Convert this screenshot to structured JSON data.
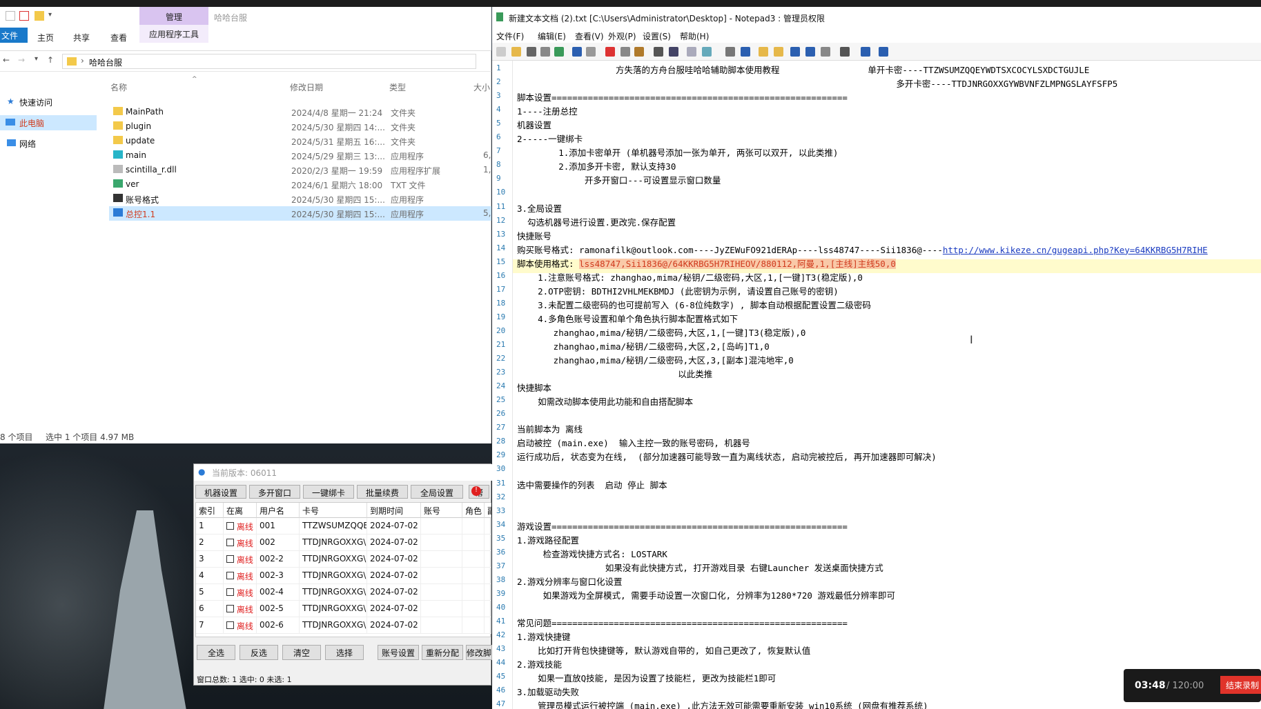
{
  "explorer": {
    "ribbon_manage": "管理",
    "ribbon_folder": "哈哈台服",
    "tabs": [
      "文件",
      "主页",
      "共享",
      "查看",
      "应用程序工具"
    ],
    "path": "哈哈台服",
    "nav": [
      "快速访问",
      "此电脑",
      "网络"
    ],
    "columns": [
      "名称",
      "修改日期",
      "类型",
      "大小"
    ],
    "files": [
      {
        "name": "MainPath",
        "date": "2024/4/8 星期一 21:24",
        "type": "文件夹",
        "size": ""
      },
      {
        "name": "plugin",
        "date": "2024/5/30 星期四 14:...",
        "type": "文件夹",
        "size": ""
      },
      {
        "name": "update",
        "date": "2024/5/31 星期五 16:...",
        "type": "文件夹",
        "size": ""
      },
      {
        "name": "main",
        "date": "2024/5/29 星期三 13:...",
        "type": "应用程序",
        "size": "6,"
      },
      {
        "name": "scintilla_r.dll",
        "date": "2020/2/3 星期一 19:59",
        "type": "应用程序扩展",
        "size": "1,"
      },
      {
        "name": "ver",
        "date": "2024/6/1 星期六 18:00",
        "type": "TXT 文件",
        "size": ""
      },
      {
        "name": "账号格式",
        "date": "2024/5/30 星期四 15:...",
        "type": "应用程序",
        "size": ""
      },
      {
        "name": "总控1.1",
        "date": "2024/5/30 星期四 15:...",
        "type": "应用程序",
        "size": "5,"
      }
    ],
    "status_items": "8 个项目",
    "status_selected": "选中 1 个项目  4.97 MB"
  },
  "tool": {
    "title": "当前版本: 06011",
    "buttons": [
      "机器设置",
      "多开窗口",
      "一键绑卡",
      "批量续费",
      "全局设置",
      "帮"
    ],
    "headers": [
      "索引",
      "在离",
      "用户名",
      "卡号",
      "到期时间",
      "账号",
      "角色",
      "副"
    ],
    "rows": [
      {
        "i": "1",
        "st": "离线",
        "user": "001",
        "card": "TTZWSUMZQQE",
        "exp": "2024-07-02"
      },
      {
        "i": "2",
        "st": "离线",
        "user": "002",
        "card": "TTDJNRGOXXG\\",
        "exp": "2024-07-02"
      },
      {
        "i": "3",
        "st": "离线",
        "user": "002-2",
        "card": "TTDJNRGOXXG\\",
        "exp": "2024-07-02"
      },
      {
        "i": "4",
        "st": "离线",
        "user": "002-3",
        "card": "TTDJNRGOXXG\\",
        "exp": "2024-07-02"
      },
      {
        "i": "5",
        "st": "离线",
        "user": "002-4",
        "card": "TTDJNRGOXXG\\",
        "exp": "2024-07-02"
      },
      {
        "i": "6",
        "st": "离线",
        "user": "002-5",
        "card": "TTDJNRGOXXG\\",
        "exp": "2024-07-02"
      },
      {
        "i": "7",
        "st": "离线",
        "user": "002-6",
        "card": "TTDJNRGOXXG\\",
        "exp": "2024-07-02"
      }
    ],
    "bottom_buttons": [
      "全选",
      "反选",
      "清空",
      "选择",
      "账号设置",
      "重新分配",
      "修改脚"
    ],
    "status": "窗口总数: 1  选中: 0  未选: 1"
  },
  "notepad": {
    "title": "新建文本文档 (2).txt [C:\\Users\\Administrator\\Desktop] - Notepad3 : 管理员权限",
    "menu": [
      "文件(F)",
      "编辑(E)",
      "查看(V)",
      "外观(P)",
      "设置(S)",
      "帮助(H)"
    ],
    "lines": [
      "                   方失落的方舟台服哇哈哈辅助脚本使用教程                 单开卡密----TTZWSUMZQQEYWDTSXCOCYLSXDCTGUJLE",
      "                                                                         多开卡密----TTDJNRGOXXGYWBVNFZLMPNGSLAYFSFP5",
      "脚本设置=========================================================",
      "1----注册总控",
      "机器设置",
      "2-----一键绑卡",
      "        1.添加卡密单开 (单机器号添加一张为单开, 两张可以双开, 以此类推)",
      "        2.添加多开卡密, 默认支持30",
      "             开多开窗口---可设置显示窗口数量",
      "",
      "3.全局设置",
      "  勾选机器号进行设置.更改完.保存配置",
      "快捷账号",
      "购买账号格式: ramonafilk@outlook.com----JyZEWuFO921dERAp----lss48747----Sii1836@----",
      "脚本使用格式: ",
      "    1.注意账号格式: zhanghao,mima/秘钥/二级密码,大区,1,[一键]T3(稳定版),0",
      "    2.OTP密钥: BDTHI2VHLMEKBMDJ (此密钥为示例, 请设置自己账号的密钥)",
      "    3.未配置二级密码的也可提前写入 (6-8位纯数字) , 脚本自动根据配置设置二级密码",
      "    4.多角色账号设置和单个角色执行脚本配置格式如下",
      "       zhanghao,mima/秘钥/二级密码,大区,1,[一键]T3(稳定版),0",
      "       zhanghao,mima/秘钥/二级密码,大区,2,[岛屿]T1,0",
      "       zhanghao,mima/秘钥/二级密码,大区,3,[副本]混沌地牢,0",
      "                               以此类推",
      "快捷脚本",
      "    如需改动脚本使用此功能和自由搭配脚本",
      "",
      "当前脚本为 离线",
      "启动被控 (main.exe)  输入主控一致的账号密码, 机器号",
      "运行成功后, 状态变为在线,  (部分加速器可能导致一直为离线状态, 启动完被控后, 再开加速器即可解决)",
      "",
      "选中需要操作的列表  启动 停止 脚本",
      "",
      "",
      "游戏设置=========================================================",
      "1.游戏路径配置",
      "     检查游戏快捷方式名: LOSTARK",
      "                 如果没有此快捷方式, 打开游戏目录 右键Launcher 发送桌面快捷方式",
      "2.游戏分辨率与窗口化设置",
      "     如果游戏为全屏模式, 需要手动设置一次窗口化, 分辨率为1280*720 游戏最低分辨率即可",
      "",
      "常见问题=========================================================",
      "1.游戏快捷键",
      "    比如打开背包快捷键等, 默认游戏自带的, 如自己更改了, 恢复默认值",
      "2.游戏技能",
      "    如果一直放Q技能, 是因为设置了技能栏, 更改为技能栏1即可",
      "3.加载驱动失败",
      "    管理员模式运行被控端 (main.exe) ,此方法无效可能需要重新安装 win10系统 (网盘有推荐系统)"
    ],
    "line14_link": "http://www.kikeze.cn/gugeapi.php?Key=64KKRBG5H7RIHE",
    "line15_selected": "lss48747,Sii1836@/64KKRBG5H7RIHEOV/880112,阿曼,1,[主线]主线50,0"
  },
  "recorder": {
    "time": "03:48",
    "total": "/ 120:00",
    "end_label": "结束录制"
  }
}
